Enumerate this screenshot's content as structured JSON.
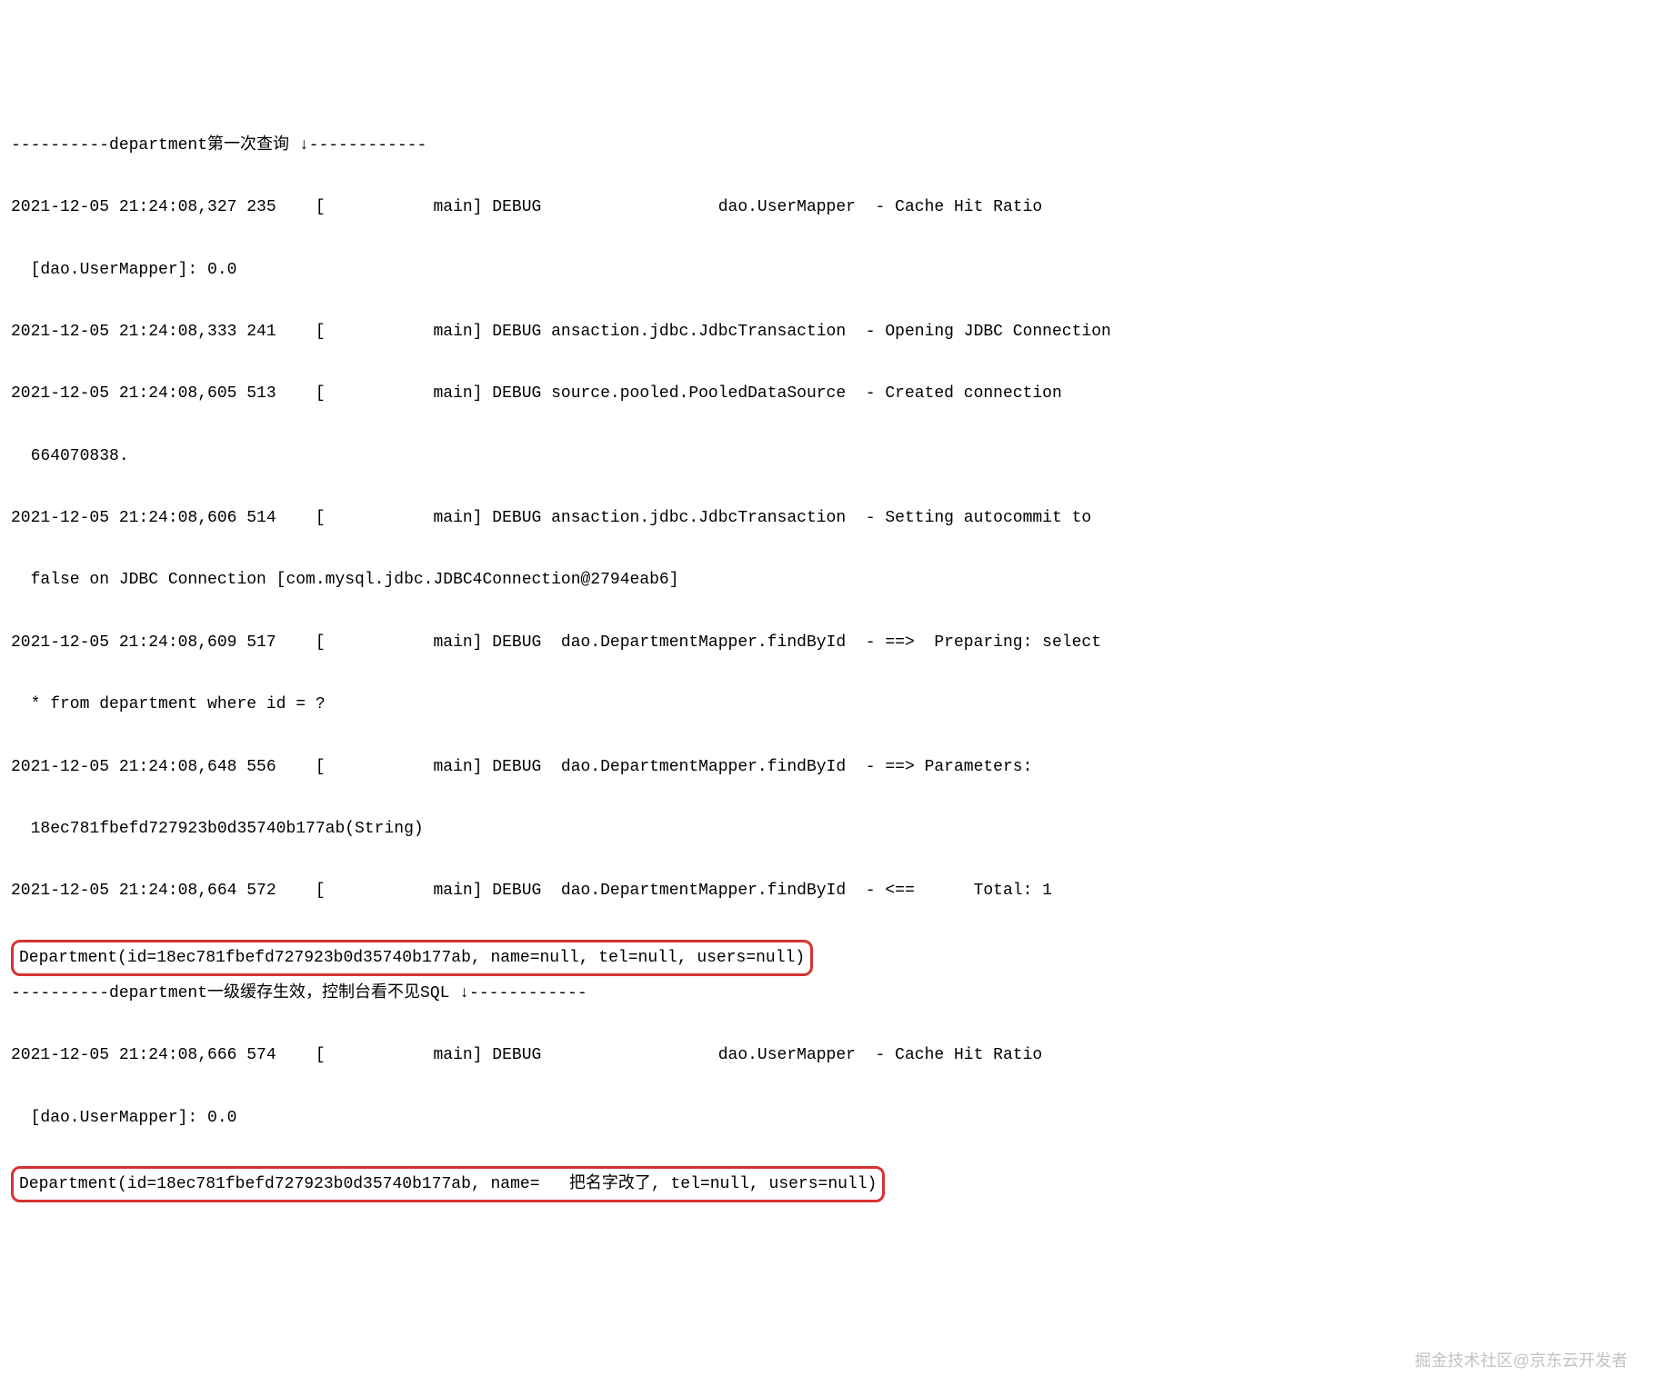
{
  "lines": {
    "l0": "----------department第一次查询 ↓------------",
    "l1": "2021-12-05 21:24:08,327 235    [           main] DEBUG                  dao.UserMapper  - Cache Hit Ratio",
    "l2": "  [dao.UserMapper]: 0.0",
    "l3": "2021-12-05 21:24:08,333 241    [           main] DEBUG ansaction.jdbc.JdbcTransaction  - Opening JDBC Connection",
    "l4": "2021-12-05 21:24:08,605 513    [           main] DEBUG source.pooled.PooledDataSource  - Created connection",
    "l5": "  664070838.",
    "l6": "2021-12-05 21:24:08,606 514    [           main] DEBUG ansaction.jdbc.JdbcTransaction  - Setting autocommit to",
    "l7": "  false on JDBC Connection [com.mysql.jdbc.JDBC4Connection@2794eab6]",
    "l8": "2021-12-05 21:24:08,609 517    [           main] DEBUG  dao.DepartmentMapper.findById  - ==>  Preparing: select",
    "l9": "  * from department where id = ?",
    "l10": "2021-12-05 21:24:08,648 556    [           main] DEBUG  dao.DepartmentMapper.findById  - ==> Parameters:",
    "l11": "  18ec781fbefd727923b0d35740b177ab(String)",
    "l12": "2021-12-05 21:24:08,664 572    [           main] DEBUG  dao.DepartmentMapper.findById  - <==      Total: 1",
    "l13": "Department(id=18ec781fbefd727923b0d35740b177ab, name=null, tel=null, users=null)",
    "l14": "----------department一级缓存生效，控制台看不见SQL ↓------------",
    "l15": "2021-12-05 21:24:08,666 574    [           main] DEBUG                  dao.UserMapper  - Cache Hit Ratio",
    "l16": "  [dao.UserMapper]: 0.0",
    "l17": "Department(id=18ec781fbefd727923b0d35740b177ab, name=   把名字改了, tel=null, users=null)"
  },
  "watermark": "掘金技术社区@京东云开发者"
}
